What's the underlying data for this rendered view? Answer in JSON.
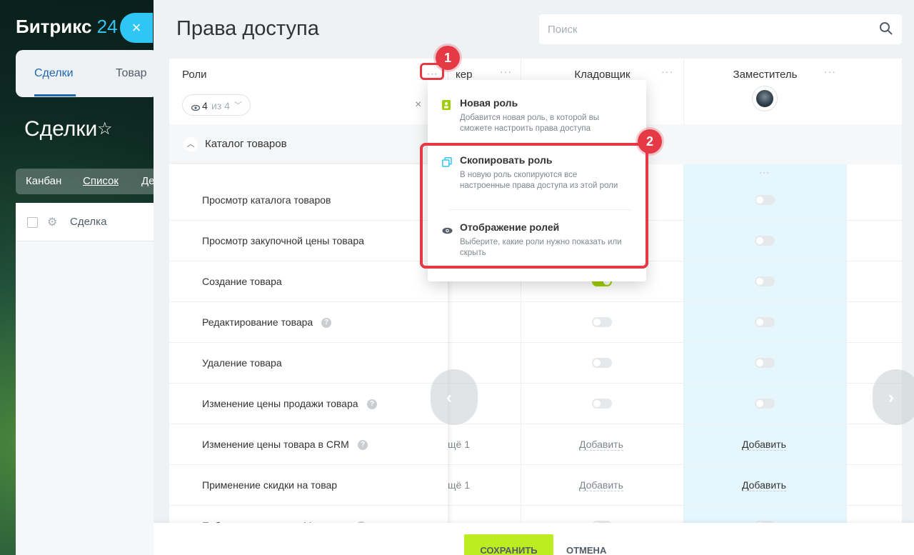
{
  "background": {
    "logo_text": "Битрикс",
    "logo_num": "24",
    "close_icon": "×",
    "tabs": [
      "Сделки",
      "Товар"
    ],
    "page_title": "Сделки",
    "views": [
      "Канбан",
      "Список",
      "Де"
    ],
    "grid_column": "Сделка"
  },
  "slider": {
    "title": "Права доступа",
    "search_placeholder": "Поиск"
  },
  "roles_header": {
    "label": "Роли",
    "visible_count": "4",
    "of_total": "из 4"
  },
  "columns": [
    {
      "name": "кер"
    },
    {
      "name": "Кладовщик"
    },
    {
      "name": "Заместитель"
    }
  ],
  "section": {
    "label": "Каталог товаров"
  },
  "rows": [
    {
      "label": "Просмотр каталога товаров",
      "help": false
    },
    {
      "label": "Просмотр закупочной цены товара",
      "help": false
    },
    {
      "label": "Создание товара",
      "help": false
    },
    {
      "label": "Редактирование товара",
      "help": true
    },
    {
      "label": "Удаление товара",
      "help": false
    },
    {
      "label": "Изменение цены продажи товара",
      "help": true
    },
    {
      "label": "Изменение цены товара в CRM",
      "help": true
    },
    {
      "label": "Применение скидки на товар",
      "help": false
    },
    {
      "label": "Публикация товара в Магазине",
      "help": true
    }
  ],
  "cells": {
    "more_label": "щё 1",
    "add_label": "Добавить",
    "toggle_on_row": "Создание товара"
  },
  "menu": {
    "items": [
      {
        "title": "Новая роль",
        "desc": "Добавится новая роль, в которой вы сможете настроить права доступа",
        "icon": "new-role-icon"
      },
      {
        "title": "Скопировать роль",
        "desc": "В новую роль скопируются все настроенные права доступа из этой роли",
        "icon": "copy-icon"
      },
      {
        "title": "Отображение ролей",
        "desc": "Выберите, какие роли нужно показать или скрыть",
        "icon": "eye-icon"
      }
    ]
  },
  "annotations": {
    "badge1": "1",
    "badge2": "2",
    "color": "#e63946"
  },
  "footer": {
    "save": "СОХРАНИТЬ",
    "cancel": "ОТМЕНА"
  },
  "colors": {
    "accent": "#2fc6f6",
    "toggle_on": "#9dcf00",
    "save_button": "#bbed21",
    "highlight_column": "#e5f7fd"
  }
}
